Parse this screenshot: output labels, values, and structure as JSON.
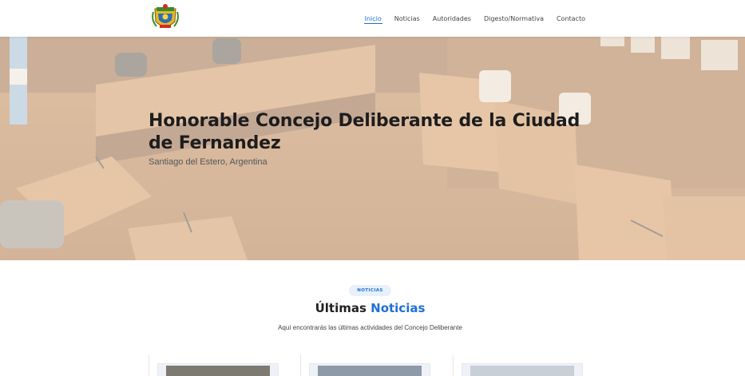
{
  "header": {
    "logo_icon": "municipal-coat-of-arms-logo",
    "nav": [
      {
        "label": "Inicio",
        "active": true
      },
      {
        "label": "Noticias",
        "active": false
      },
      {
        "label": "Autoridades",
        "active": false
      },
      {
        "label": "Digesto/Normativa",
        "active": false
      },
      {
        "label": "Contacto",
        "active": false
      }
    ]
  },
  "hero": {
    "title": "Honorable Concejo Deliberante de la Ciudad de Fernandez",
    "subtitle": "Santiago del Estero, Argentina",
    "background": "council-chamber-photo"
  },
  "news_section": {
    "badge": "NOTICIAS",
    "title_prefix": "Últimas",
    "title_highlight": "Noticias",
    "subtitle": "Aquí encontrarás las últimas actividades del Concejo Deliberante"
  },
  "colors": {
    "accent": "#1e6fd9",
    "badge_bg": "#e8f0fb",
    "text_dark": "#1d1d1d"
  }
}
